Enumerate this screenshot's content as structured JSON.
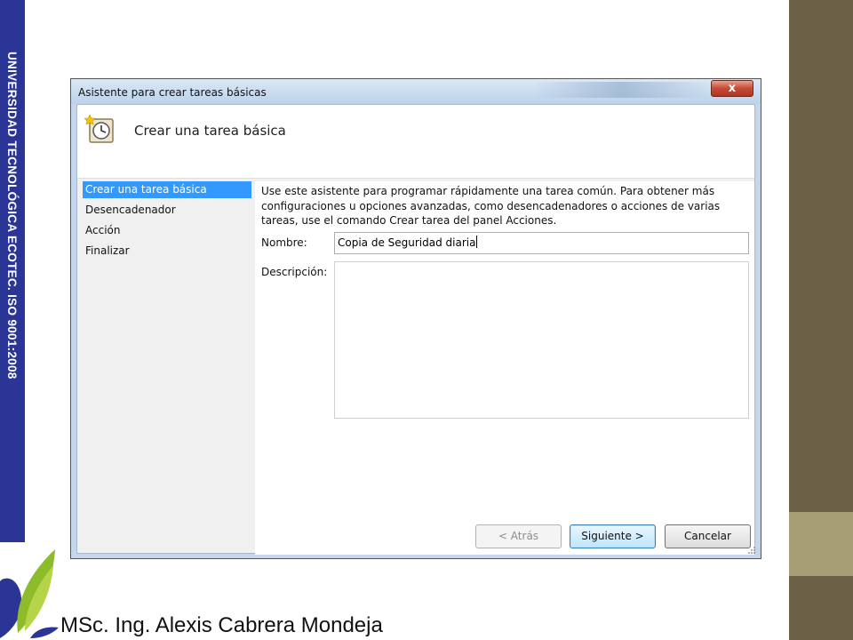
{
  "slide": {
    "side_banner": "UNIVERSIDAD TECNOLÓGICA ECOTEC. ISO 9001:2008",
    "author": "MSc. Ing. Alexis Cabrera Mondeja",
    "colors": {
      "banner": "#2b3595",
      "right_dark": "#6b5f46",
      "right_light": "#a69f75"
    }
  },
  "window": {
    "title": "Asistente para crear tareas básicas",
    "close_label": "x",
    "header_title": "Crear una tarea básica",
    "nav_items": [
      {
        "label": "Crear una tarea básica",
        "active": true
      },
      {
        "label": "Desencadenador",
        "active": false
      },
      {
        "label": "Acción",
        "active": false
      },
      {
        "label": "Finalizar",
        "active": false
      }
    ],
    "intro_text": "Use este asistente para programar rápidamente una tarea común. Para obtener más configuraciones u opciones avanzadas, como desencadenadores o acciones de varias tareas, use el comando Crear tarea del panel Acciones.",
    "name_label": "Nombre:",
    "name_value": "Copia de Seguridad diaria",
    "description_label": "Descripción:",
    "description_value": "",
    "buttons": {
      "back": "< Atrás",
      "next": "Siguiente >",
      "cancel": "Cancelar"
    },
    "header_icon": "scheduled-task-clock-icon"
  }
}
